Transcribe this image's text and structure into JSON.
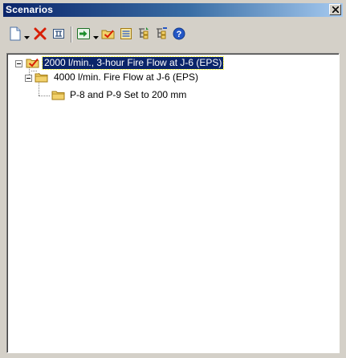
{
  "panel": {
    "title": "Scenarios",
    "close_icon": "close-icon"
  },
  "toolbar": {
    "buttons": [
      {
        "name": "new-button",
        "icon": "new-document-icon",
        "has_dropdown": true
      },
      {
        "name": "delete-button",
        "icon": "red-x-delete-icon"
      },
      {
        "name": "rename-button",
        "icon": "rename-icon"
      },
      {
        "name": "compute-button",
        "icon": "green-arrow-icon",
        "has_dropdown": true
      },
      {
        "name": "make-current-button",
        "icon": "checked-folder-icon"
      },
      {
        "name": "properties-button",
        "icon": "properties-icon"
      },
      {
        "name": "expand-button",
        "icon": "expand-tree-icon"
      },
      {
        "name": "collapse-button",
        "icon": "collapse-tree-icon"
      },
      {
        "name": "help-button",
        "icon": "help-icon"
      }
    ]
  },
  "tree": {
    "nodes": [
      {
        "label": "2000 l/min., 3-hour Fire Flow at J-6 (EPS)",
        "icon": "active-scenario-icon",
        "level": 0,
        "expanded": true,
        "selected": true
      },
      {
        "label": "4000 l/min. Fire Flow at J-6 (EPS)",
        "icon": "scenario-folder-icon",
        "level": 1,
        "expanded": true,
        "selected": false
      },
      {
        "label": "P-8 and P-9 Set to 200 mm",
        "icon": "scenario-folder-icon",
        "level": 2,
        "expanded": false,
        "selected": false
      }
    ]
  },
  "colors": {
    "title_bar": "#0a246a",
    "selection": "#0a246a",
    "delete_red": "#d81e05",
    "folder_yellow": "#f2d16b",
    "arrow_green": "#1c8f2c",
    "help_blue": "#2457c5"
  }
}
